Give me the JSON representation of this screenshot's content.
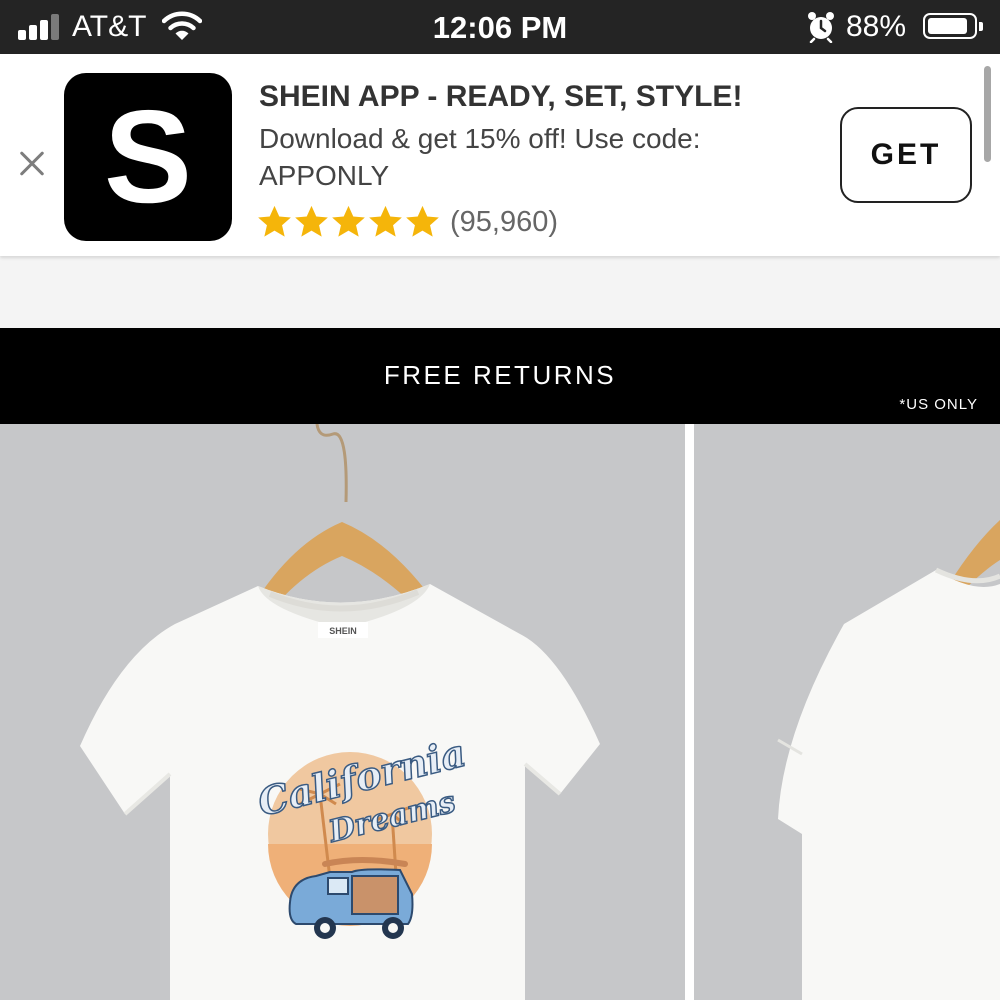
{
  "status_bar": {
    "carrier": "AT&T",
    "time": "12:06 PM",
    "battery_percent": "88%",
    "battery_level": 0.88,
    "icons": [
      "signal-icon",
      "wifi-icon",
      "alarm-icon",
      "battery-icon"
    ]
  },
  "smart_banner": {
    "icon_letter": "S",
    "title": "SHEIN APP - READY, SET, STYLE!",
    "description": "Download & get 15% off! Use code: APPONLY",
    "rating_stars": 5,
    "rating_count": "(95,960)",
    "get_label": "GET",
    "star_color": "#f5b50a"
  },
  "promo_bar": {
    "text": "FREE RETURNS",
    "note": "*US ONLY"
  },
  "gallery": {
    "shirt_print": {
      "line1": "California",
      "line2": "Dreams"
    },
    "tag_text": "SHEIN"
  },
  "colors": {
    "status_bar_bg": "#242424",
    "promo_bg": "#000000",
    "photo_bg": "#c6c7c9",
    "tee": "#f8f8f6"
  }
}
